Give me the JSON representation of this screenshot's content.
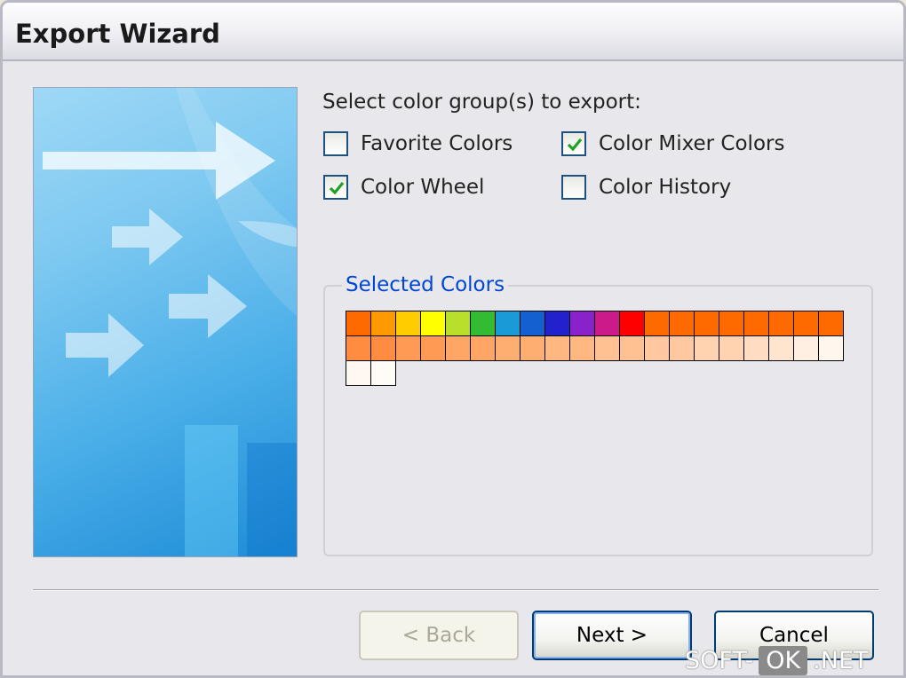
{
  "window": {
    "title": "Export Wizard"
  },
  "prompt": "Select color group(s) to export:",
  "checkboxes": [
    {
      "label": "Favorite Colors",
      "checked": false
    },
    {
      "label": "Color Mixer Colors",
      "checked": true
    },
    {
      "label": "Color Wheel",
      "checked": true
    },
    {
      "label": "Color History",
      "checked": false
    }
  ],
  "selected_colors": {
    "title": "Selected Colors",
    "swatches": [
      "#ff6a00",
      "#ff9900",
      "#ffcc00",
      "#ffff00",
      "#b8e02a",
      "#33bb33",
      "#1a9ad6",
      "#1560d0",
      "#2222cc",
      "#8a22cc",
      "#cc1a8a",
      "#ff0000",
      "#ff6a00",
      "#ff6a00",
      "#ff6a00",
      "#ff6a00",
      "#ff6a00",
      "#ff6a00",
      "#ff6a00",
      "#ff6a00",
      "#ff8c40",
      "#ff8c40",
      "#ff9a55",
      "#ff9a55",
      "#ffa565",
      "#ffa565",
      "#ffae72",
      "#ffae72",
      "#ffb882",
      "#ffb882",
      "#ffc092",
      "#ffc092",
      "#ffc8a0",
      "#ffc8a0",
      "#ffd2b0",
      "#ffd2b0",
      "#ffdcc2",
      "#ffe4d0",
      "#ffeee2",
      "#fff6ee",
      "#fff8f2",
      "#fffcf8"
    ]
  },
  "buttons": {
    "back": "< Back",
    "next": "Next >",
    "cancel": "Cancel"
  },
  "watermark": {
    "left": "SOFT-",
    "box": "OK",
    "right": ".NET"
  },
  "colors": {
    "group_title": "#0046d5",
    "checkmark": "#21a121",
    "banner": "#49aee8"
  }
}
